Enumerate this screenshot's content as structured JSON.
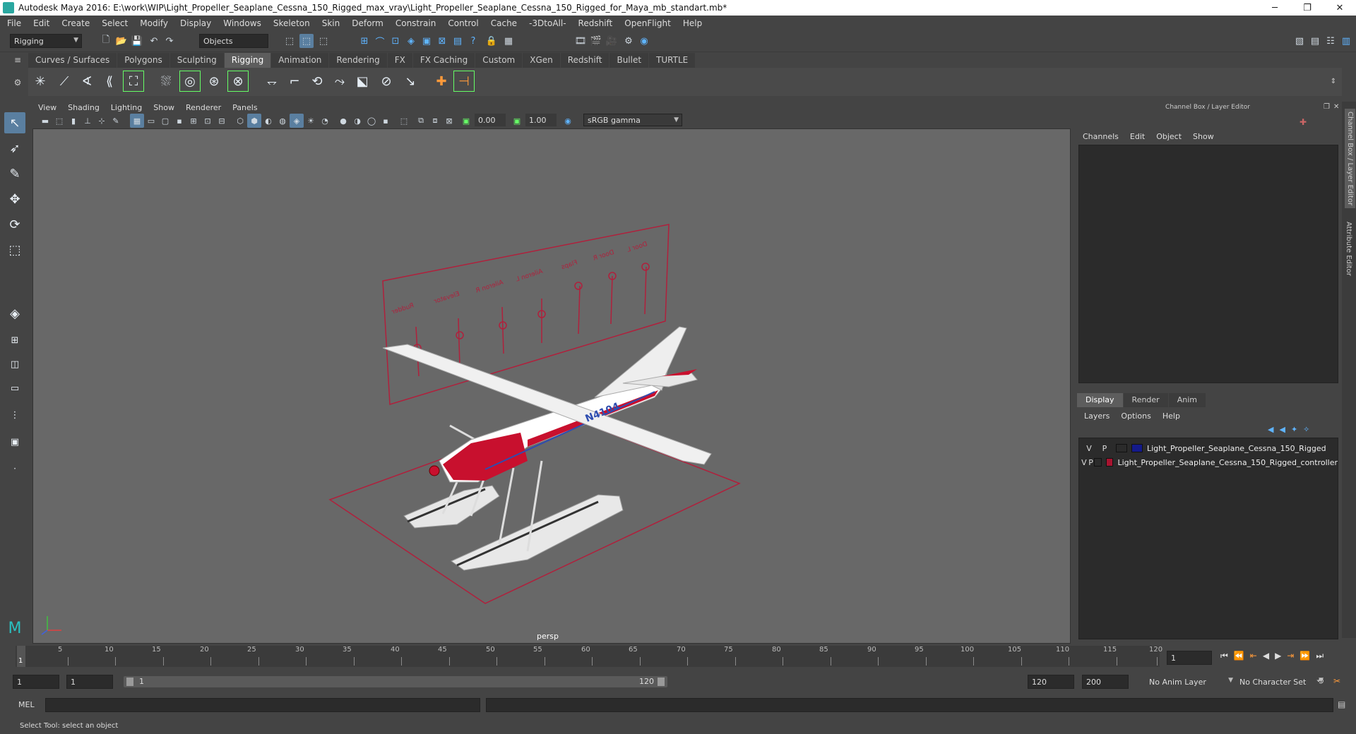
{
  "window": {
    "title": "Autodesk Maya 2016: E:\\work\\WIP\\Light_Propeller_Seaplane_Cessna_150_Rigged_max_vray\\Light_Propeller_Seaplane_Cessna_150_Rigged_for_Maya_mb_standart.mb*",
    "minimize": "─",
    "restore": "❐",
    "close": "✕"
  },
  "menubar": [
    "File",
    "Edit",
    "Create",
    "Select",
    "Modify",
    "Display",
    "Windows",
    "Skeleton",
    "Skin",
    "Deform",
    "Constrain",
    "Control",
    "Cache",
    "-3DtoAll-",
    "Redshift",
    "OpenFlight",
    "Help"
  ],
  "statusline": {
    "mode": "Rigging",
    "selection_mask": "Objects"
  },
  "shelf": {
    "tabs": [
      "Curves / Surfaces",
      "Polygons",
      "Sculpting",
      "Rigging",
      "Animation",
      "Rendering",
      "FX",
      "FX Caching",
      "Custom",
      "XGen",
      "Redshift",
      "Bullet",
      "TURTLE"
    ],
    "active_tab": "Rigging"
  },
  "viewport": {
    "menu": [
      "View",
      "Shading",
      "Lighting",
      "Show",
      "Renderer",
      "Panels"
    ],
    "exposure": "0.00",
    "gamma": "1.00",
    "color_space": "sRGB gamma",
    "camera_label": "persp",
    "controller_labels": [
      "Rudder",
      "Elevator",
      "Aileron R",
      "Aileron L",
      "Flaps",
      "Door R",
      "Door L"
    ],
    "tail_number": "N4104"
  },
  "channel_box": {
    "header": "Channel Box / Layer Editor",
    "menu": [
      "Channels",
      "Edit",
      "Object",
      "Show"
    ]
  },
  "layer_editor": {
    "tabs": [
      "Display",
      "Render",
      "Anim"
    ],
    "active_tab": "Display",
    "menu": [
      "Layers",
      "Options",
      "Help"
    ],
    "layers": [
      {
        "v": "V",
        "p": "P",
        "name": "Light_Propeller_Seaplane_Cessna_150_Rigged",
        "color": "#141a8a"
      },
      {
        "v": "V",
        "p": "P",
        "name": "Light_Propeller_Seaplane_Cessna_150_Rigged_controller",
        "color": "#a81430"
      }
    ]
  },
  "side_tabs": {
    "channel_box": "Channel Box / Layer Editor",
    "attribute_editor": "Attribute Editor"
  },
  "timeslider": {
    "ticks": [
      "1",
      "5",
      "10",
      "15",
      "20",
      "25",
      "30",
      "35",
      "40",
      "45",
      "50",
      "55",
      "60",
      "65",
      "70",
      "75",
      "80",
      "85",
      "90",
      "95",
      "100",
      "105",
      "110",
      "115",
      "120"
    ],
    "current_frame": "1"
  },
  "range": {
    "start": "1",
    "playback_start": "1",
    "range_start_label": "1",
    "range_end_label": "120",
    "playback_end": "120",
    "end": "200",
    "anim_layer": "No Anim Layer",
    "character_set": "No Character Set"
  },
  "command_line": {
    "label": "MEL"
  },
  "help_line": "Select Tool: select an object"
}
